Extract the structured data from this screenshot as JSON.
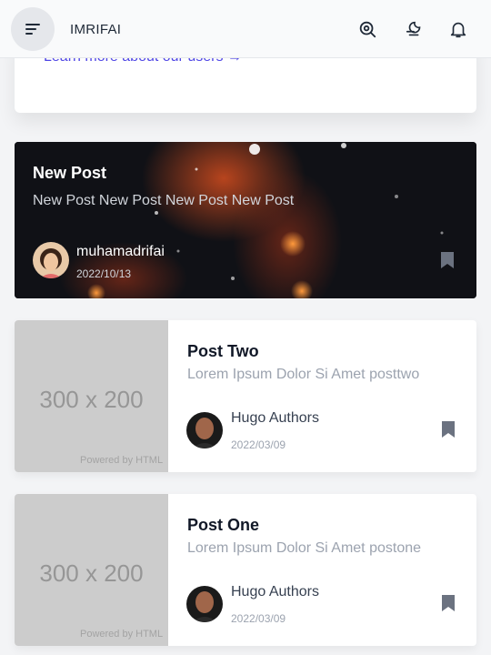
{
  "header": {
    "brand": "IMRIFAI",
    "icons": [
      "menu-icon",
      "search-icon",
      "moon-icon",
      "bell-icon"
    ]
  },
  "top_card": {
    "link_text": "Learn more about our users →"
  },
  "featured": {
    "title": "New Post",
    "subtitle": "New Post New Post New Post New Post",
    "author": "muhamadrifai",
    "date": "2022/10/13"
  },
  "posts": [
    {
      "title": "Post Two",
      "subtitle": "Lorem Ipsum Dolor Si Amet posttwo",
      "thumb_text": "300 x 200",
      "thumb_powered": "Powered by HTML",
      "author": "Hugo Authors",
      "date": "2022/03/09"
    },
    {
      "title": "Post One",
      "subtitle": "Lorem Ipsum Dolor Si Amet postone",
      "thumb_text": "300 x 200",
      "thumb_powered": "Powered by HTML",
      "author": "Hugo Authors",
      "date": "2022/03/09"
    }
  ],
  "colors": {
    "link": "#4f46e5",
    "background": "#f3f4f6",
    "placeholder": "#cccccc",
    "bookmark": "#6b7280"
  }
}
